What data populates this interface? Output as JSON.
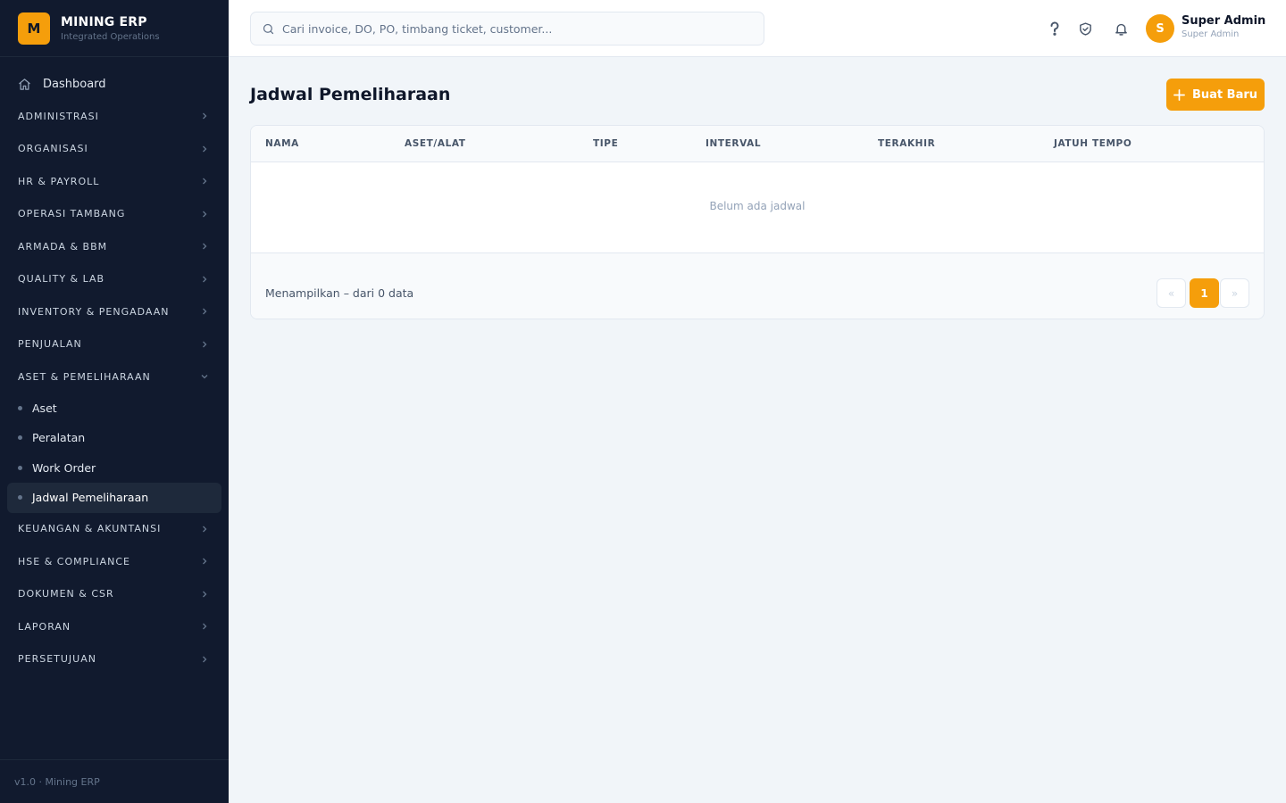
{
  "brand": {
    "logo_letter": "M",
    "title": "MINING ERP",
    "subtitle": "Integrated Operations"
  },
  "sidebar": {
    "dashboard_label": "Dashboard",
    "sections_before": [
      "ADMINISTRASI",
      "ORGANISASI",
      "HR & PAYROLL",
      "OPERASI TAMBANG",
      "ARMADA & BBM",
      "QUALITY & LAB",
      "INVENTORY & PENGADAAN",
      "PENJUALAN"
    ],
    "expanded_section": "ASET & PEMELIHARAAN",
    "sub_items": [
      "Aset",
      "Peralatan",
      "Work Order",
      "Jadwal Pemeliharaan"
    ],
    "active_sub_item": "Jadwal Pemeliharaan",
    "sections_after": [
      "KEUANGAN & AKUNTANSI",
      "HSE & COMPLIANCE",
      "DOKUMEN & CSR",
      "LAPORAN",
      "PERSETUJUAN"
    ],
    "version": "v1.0 · Mining ERP"
  },
  "topbar": {
    "search_placeholder": "Cari invoice, DO, PO, timbang ticket, customer...",
    "icons": [
      "help-icon",
      "shield-check-icon",
      "bell-icon"
    ],
    "avatar_letter": "S",
    "user_name": "Super Admin",
    "user_role": "Super Admin"
  },
  "page": {
    "title": "Jadwal Pemeliharaan",
    "new_button": "Buat Baru"
  },
  "table": {
    "columns": [
      "NAMA",
      "ASET/ALAT",
      "TIPE",
      "INTERVAL",
      "TERAKHIR",
      "JATUH TEMPO"
    ],
    "rows": [],
    "empty_text": "Belum ada jadwal",
    "footer_text": "Menampilkan – dari 0 data",
    "pagination": {
      "prev": "«",
      "current": "1",
      "next": "»"
    }
  },
  "colors": {
    "accent": "#f59e0b",
    "sidebar_bg": "#111a2e",
    "page_bg": "#f1f5f9"
  }
}
